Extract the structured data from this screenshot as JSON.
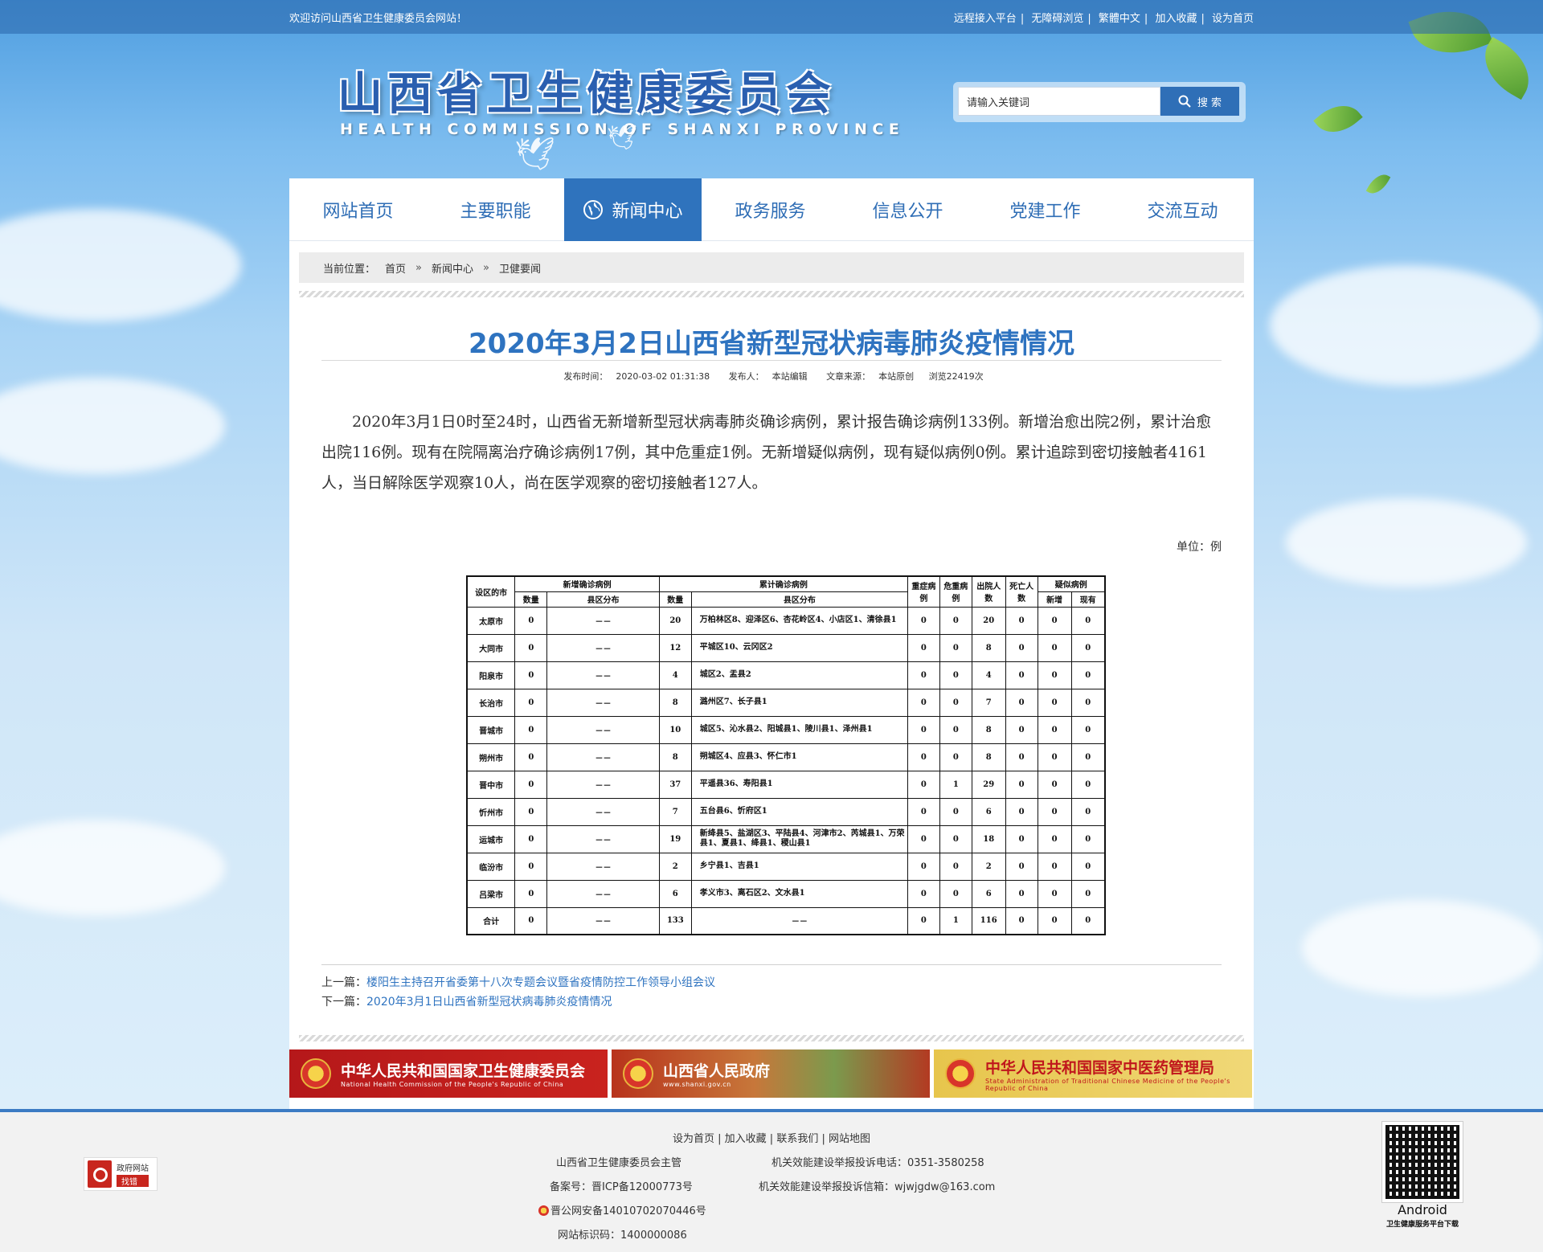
{
  "topbar": {
    "welcome": "欢迎访问山西省卫生健康委员会网站！",
    "links": [
      "远程接入平台",
      "无障碍浏览",
      "繁體中文",
      "加入收藏",
      "设为首页"
    ]
  },
  "header": {
    "logo_cn": "山西省卫生健康委员会",
    "logo_en": "HEALTH COMMISSION OF SHANXI PROVINCE"
  },
  "search": {
    "placeholder": "请输入关键词",
    "value": "请输入关键词",
    "button_label": "搜 索"
  },
  "nav": {
    "items": [
      "网站首页",
      "主要职能",
      "新闻中心",
      "政务服务",
      "信息公开",
      "党建工作",
      "交流互动"
    ],
    "active": "新闻中心"
  },
  "breadcrumb": {
    "label": "当前位置：",
    "items": [
      "首页",
      "新闻中心",
      "卫健要闻"
    ],
    "separator": "»"
  },
  "article": {
    "title": "2020年3月2日山西省新型冠状病毒肺炎疫情情况",
    "meta": {
      "time_label": "发布时间：",
      "time": "2020-03-02 01:31:38",
      "author_label": "发布人：",
      "author": "本站编辑",
      "source_label": "文章来源：",
      "source": "本站原创",
      "views": "浏览22419次"
    },
    "body": "2020年3月1日0时至24时，山西省无新增新型冠状病毒肺炎确诊病例，累计报告确诊病例133例。新增治愈出院2例，累计治愈出院116例。现有在院隔离治疗确诊病例17例，其中危重症1例。无新增疑似病例，现有疑似病例0例。累计追踪到密切接触者4161人，当日解除医学观察10人，尚在医学观察的密切接触者127人。",
    "unit": "单位：例"
  },
  "table": {
    "headers": {
      "city": "设区的市",
      "new_confirmed": "新增确诊病例",
      "cumulative_confirmed": "累计确诊病例",
      "count": "数量",
      "district": "县区分布",
      "severe": "重症病例",
      "critical": "危重病例",
      "discharged": "出院人数",
      "death": "死亡人数",
      "suspected": "疑似病例",
      "suspected_new": "新增",
      "suspected_current": "现有"
    },
    "rows": [
      {
        "city": "太原市",
        "new": "0",
        "new_dist": "－－",
        "cum": "20",
        "cum_dist": "万柏林区8、迎泽区6、杏花岭区4、小店区1、清徐县1",
        "severe": "0",
        "critical": "0",
        "discharged": "20",
        "death": "0",
        "s_new": "0",
        "s_cur": "0"
      },
      {
        "city": "大同市",
        "new": "0",
        "new_dist": "－－",
        "cum": "12",
        "cum_dist": "平城区10、云冈区2",
        "severe": "0",
        "critical": "0",
        "discharged": "8",
        "death": "0",
        "s_new": "0",
        "s_cur": "0"
      },
      {
        "city": "阳泉市",
        "new": "0",
        "new_dist": "－－",
        "cum": "4",
        "cum_dist": "城区2、盂县2",
        "severe": "0",
        "critical": "0",
        "discharged": "4",
        "death": "0",
        "s_new": "0",
        "s_cur": "0"
      },
      {
        "city": "长治市",
        "new": "0",
        "new_dist": "－－",
        "cum": "8",
        "cum_dist": "潞州区7、长子县1",
        "severe": "0",
        "critical": "0",
        "discharged": "7",
        "death": "0",
        "s_new": "0",
        "s_cur": "0"
      },
      {
        "city": "晋城市",
        "new": "0",
        "new_dist": "－－",
        "cum": "10",
        "cum_dist": "城区5、沁水县2、阳城县1、陵川县1、泽州县1",
        "severe": "0",
        "critical": "0",
        "discharged": "8",
        "death": "0",
        "s_new": "0",
        "s_cur": "0"
      },
      {
        "city": "朔州市",
        "new": "0",
        "new_dist": "－－",
        "cum": "8",
        "cum_dist": "朔城区4、应县3、怀仁市1",
        "severe": "0",
        "critical": "0",
        "discharged": "8",
        "death": "0",
        "s_new": "0",
        "s_cur": "0"
      },
      {
        "city": "晋中市",
        "new": "0",
        "new_dist": "－－",
        "cum": "37",
        "cum_dist": "平遥县36、寿阳县1",
        "severe": "0",
        "critical": "1",
        "discharged": "29",
        "death": "0",
        "s_new": "0",
        "s_cur": "0"
      },
      {
        "city": "忻州市",
        "new": "0",
        "new_dist": "－－",
        "cum": "7",
        "cum_dist": "五台县6、忻府区1",
        "severe": "0",
        "critical": "0",
        "discharged": "6",
        "death": "0",
        "s_new": "0",
        "s_cur": "0"
      },
      {
        "city": "运城市",
        "new": "0",
        "new_dist": "－－",
        "cum": "19",
        "cum_dist": "新绛县5、盐湖区3、平陆县4、河津市2、芮城县1、万荣县1、夏县1、绛县1、稷山县1",
        "severe": "0",
        "critical": "0",
        "discharged": "18",
        "death": "0",
        "s_new": "0",
        "s_cur": "0"
      },
      {
        "city": "临汾市",
        "new": "0",
        "new_dist": "－－",
        "cum": "2",
        "cum_dist": "乡宁县1、吉县1",
        "severe": "0",
        "critical": "0",
        "discharged": "2",
        "death": "0",
        "s_new": "0",
        "s_cur": "0"
      },
      {
        "city": "吕梁市",
        "new": "0",
        "new_dist": "－－",
        "cum": "6",
        "cum_dist": "孝义市3、离石区2、文水县1",
        "severe": "0",
        "critical": "0",
        "discharged": "6",
        "death": "0",
        "s_new": "0",
        "s_cur": "0"
      },
      {
        "city": "合计",
        "new": "0",
        "new_dist": "－－",
        "cum": "133",
        "cum_dist": "－－",
        "severe": "0",
        "critical": "1",
        "discharged": "116",
        "death": "0",
        "s_new": "0",
        "s_cur": "0"
      }
    ]
  },
  "prevnext": {
    "prev_label": "上一篇：",
    "prev_title": "楼阳生主持召开省委第十八次专题会议暨省疫情防控工作领导小组会议",
    "next_label": "下一篇：",
    "next_title": "2020年3月1日山西省新型冠状病毒肺炎疫情情况"
  },
  "banners": [
    {
      "cn": "中华人民共和国国家卫生健康委员会",
      "en": "National Health Commission of the People's Republic of China"
    },
    {
      "cn": "山西省人民政府",
      "en": "www.shanxi.gov.cn"
    },
    {
      "cn": "中华人民共和国国家中医药管理局",
      "en": "State Administration of Traditional Chinese Medicine of the People's Republic of China"
    }
  ],
  "footer": {
    "links": [
      "设为首页",
      "加入收藏",
      "联系我们",
      "网站地图"
    ],
    "sponsor": "山西省卫生健康委员会主管",
    "complaint_phone": "机关效能建设举报投诉电话：0351-3580258",
    "icp": "备案号：晋ICP备12000773号",
    "complaint_email": "机关效能建设举报投诉信箱：wjwjgdw@163.com",
    "police": "晋公网安备14010702070446号",
    "site_id": "网站标识码：1400000086",
    "gov_badge_top": "政府网站",
    "gov_badge_bottom": "找错",
    "qr_label": "Android",
    "qr_sub": "卫生健康服务平台下载"
  }
}
